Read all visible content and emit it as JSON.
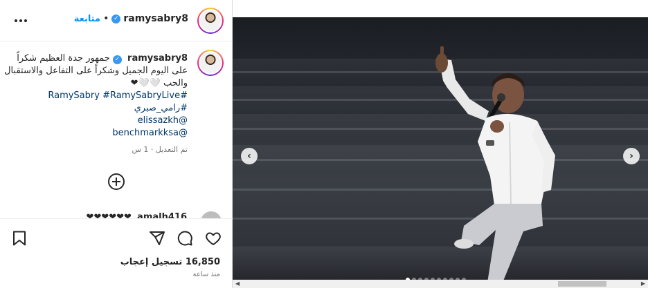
{
  "header": {
    "username": "ramysabry8",
    "verified_mark": "✓",
    "separator": "•",
    "follow_label": "متابعة",
    "more_icon": "more-horizontal-icon"
  },
  "caption": {
    "username": "ramysabry8",
    "verified_mark": "✓",
    "line1": "جمهور جدة العظيم شكراً",
    "line2": "على اليوم الجميل وشكراً على التفاعل والاستقبال",
    "line3": "والحب 🤍🤍❤",
    "tags": [
      "#RamySabry #RamySabryLive",
      "#رامي_صبري",
      "@elissazkh",
      "@benchmarkksa"
    ],
    "edited": "تم التعديل · 1 س"
  },
  "comment_peek": {
    "username": "amalh416",
    "text": "❤❤❤❤❤❤"
  },
  "actions": {
    "like_icon": "heart-icon",
    "comment_icon": "comment-icon",
    "share_icon": "share-icon",
    "save_icon": "bookmark-icon",
    "add_comment_icon": "plus-circle-icon",
    "likes_count": "16,850",
    "likes_label": "تسجيل إعجاب",
    "time": "منذ ساعة"
  },
  "media": {
    "prev_arrow": "‹",
    "next_arrow": "›",
    "carousel_dots": 10,
    "active_dot": 0
  },
  "colors": {
    "accent": "#0095f6",
    "verified": "#3897f0",
    "text": "#262626",
    "muted": "#737373"
  }
}
